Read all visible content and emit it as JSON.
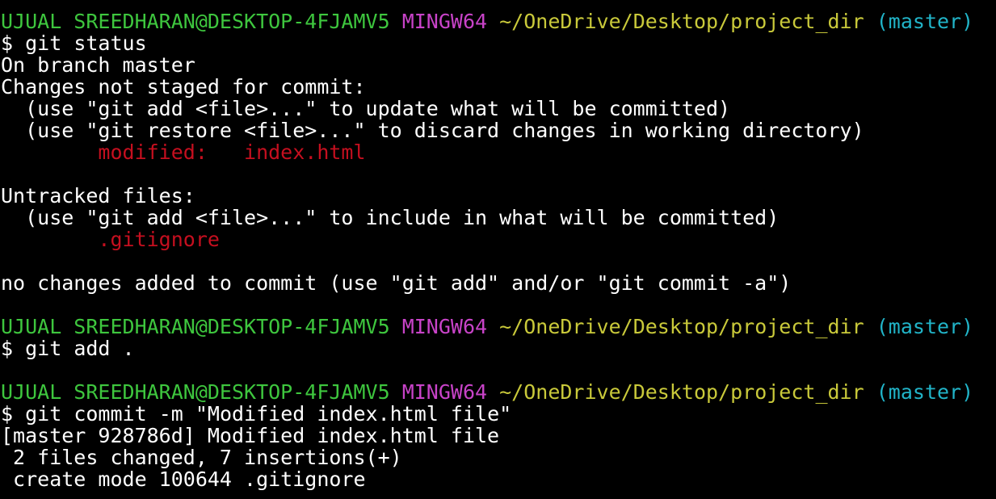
{
  "colors": {
    "background": "#000000",
    "default_text": "#ffffff",
    "user_host": "#3ec63e",
    "system": "#c843c8",
    "path": "#c9c93a",
    "branch": "#21b4c8",
    "modified_untracked": "#c50f1f"
  },
  "prompt": {
    "user_host": "UJUAL SREEDHARAN@DESKTOP-4FJAMV5",
    "system": "MINGW64",
    "path": "~/OneDrive/Desktop/project_dir",
    "branch": "(master)",
    "symbol": "$"
  },
  "blocks": [
    {
      "command": "git status",
      "output": [
        {
          "text": "On branch master",
          "color": "white"
        },
        {
          "text": "Changes not staged for commit:",
          "color": "white"
        },
        {
          "text": "  (use \"git add <file>...\" to update what will be committed)",
          "color": "white"
        },
        {
          "text": "  (use \"git restore <file>...\" to discard changes in working directory)",
          "color": "white"
        },
        {
          "text": "        modified:   index.html",
          "color": "red"
        },
        {
          "text": "",
          "color": "white"
        },
        {
          "text": "Untracked files:",
          "color": "white"
        },
        {
          "text": "  (use \"git add <file>...\" to include in what will be committed)",
          "color": "white"
        },
        {
          "text": "        .gitignore",
          "color": "red"
        },
        {
          "text": "",
          "color": "white"
        },
        {
          "text": "no changes added to commit (use \"git add\" and/or \"git commit -a\")",
          "color": "white"
        },
        {
          "text": "",
          "color": "white"
        }
      ]
    },
    {
      "command": "git add .",
      "output": [
        {
          "text": "",
          "color": "white"
        }
      ]
    },
    {
      "command": "git commit -m \"Modified index.html file\"",
      "output": [
        {
          "text": "[master 928786d] Modified index.html file",
          "color": "white"
        },
        {
          "text": " 2 files changed, 7 insertions(+)",
          "color": "white"
        },
        {
          "text": " create mode 100644 .gitignore",
          "color": "white"
        }
      ]
    }
  ]
}
